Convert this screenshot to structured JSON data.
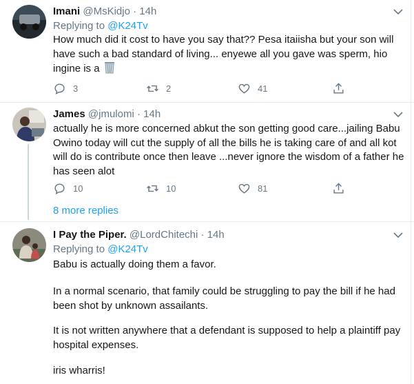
{
  "tweets": [
    {
      "name": "Imani",
      "handle": "@MsKidjo",
      "dot": "·",
      "time": "14h",
      "replying_label": "Replying to",
      "replying_to": "@K24Tv",
      "text": "How much did it cost to have you say that?? Pesa itaiisha but your son will have such a bad standard of living... enyewe all you gave was sperm, hio ingine is a",
      "emoji": "wastebasket",
      "replies": "3",
      "retweets": "2",
      "likes": "41"
    },
    {
      "name": "James",
      "handle": "@jmulomi",
      "dot": "·",
      "time": "14h",
      "text": "actually he is more concerned abkut the son getting good care...jailing Babu Owino today will cut the supply of all the bills he is taking care of and all kot will do is contribute once then leave ...never ignore the wisdom of a father he has seen alot",
      "replies": "10",
      "retweets": "10",
      "likes": "81"
    },
    {
      "name": "I Pay the Piper.",
      "handle": "@LordChitechi",
      "dot": "·",
      "time": "14h",
      "replying_label": "Replying to",
      "replying_to": "@K24Tv",
      "paragraphs": [
        "Babu is actually doing them a favor.",
        "In a normal scenario, that family could be struggling to pay the bill if he had been shot by unknown assailants.",
        "It is not written anywhere that a defendant is supposed to help a plaintiff pay hospital expenses.",
        "iris wharris!"
      ]
    }
  ],
  "more_replies": "8 more replies",
  "colors": {
    "accent": "#1da1f2",
    "muted": "#657786",
    "border": "#e6ecf0"
  }
}
